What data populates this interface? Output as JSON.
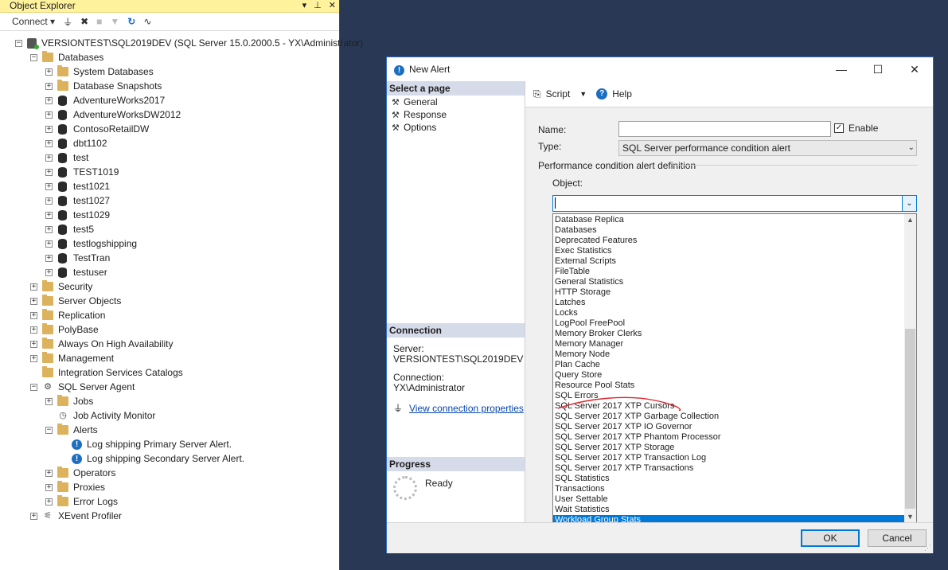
{
  "oe": {
    "title": "Object Explorer",
    "connect_label": "Connect",
    "tree": [
      {
        "label": "VERSIONTEST\\SQL2019DEV (SQL Server 15.0.2000.5 - YX\\Administrator)",
        "level": 0,
        "icon": "server-icon",
        "exp": "-"
      },
      {
        "label": "Databases",
        "level": 1,
        "icon": "folder-icon",
        "exp": "-"
      },
      {
        "label": "System Databases",
        "level": 2,
        "icon": "folder-icon",
        "exp": "+"
      },
      {
        "label": "Database Snapshots",
        "level": 2,
        "icon": "folder-icon",
        "exp": "+"
      },
      {
        "label": "AdventureWorks2017",
        "level": 2,
        "icon": "database-icon",
        "exp": "+"
      },
      {
        "label": "AdventureWorksDW2012",
        "level": 2,
        "icon": "database-icon",
        "exp": "+"
      },
      {
        "label": "ContosoRetailDW",
        "level": 2,
        "icon": "database-icon",
        "exp": "+"
      },
      {
        "label": "dbt1102",
        "level": 2,
        "icon": "database-icon",
        "exp": "+"
      },
      {
        "label": "test",
        "level": 2,
        "icon": "database-icon",
        "exp": "+"
      },
      {
        "label": "TEST1019",
        "level": 2,
        "icon": "database-icon",
        "exp": "+"
      },
      {
        "label": "test1021",
        "level": 2,
        "icon": "database-icon",
        "exp": "+"
      },
      {
        "label": "test1027",
        "level": 2,
        "icon": "database-icon",
        "exp": "+"
      },
      {
        "label": "test1029",
        "level": 2,
        "icon": "database-icon",
        "exp": "+"
      },
      {
        "label": "test5",
        "level": 2,
        "icon": "database-icon",
        "exp": "+"
      },
      {
        "label": "testlogshipping",
        "level": 2,
        "icon": "database-icon",
        "exp": "+"
      },
      {
        "label": "TestTran",
        "level": 2,
        "icon": "database-icon",
        "exp": "+"
      },
      {
        "label": "testuser",
        "level": 2,
        "icon": "database-icon",
        "exp": "+"
      },
      {
        "label": "Security",
        "level": 1,
        "icon": "folder-icon",
        "exp": "+"
      },
      {
        "label": "Server Objects",
        "level": 1,
        "icon": "folder-icon",
        "exp": "+"
      },
      {
        "label": "Replication",
        "level": 1,
        "icon": "folder-icon",
        "exp": "+"
      },
      {
        "label": "PolyBase",
        "level": 1,
        "icon": "folder-icon",
        "exp": "+"
      },
      {
        "label": "Always On High Availability",
        "level": 1,
        "icon": "folder-icon",
        "exp": "+"
      },
      {
        "label": "Management",
        "level": 1,
        "icon": "folder-icon",
        "exp": "+"
      },
      {
        "label": "Integration Services Catalogs",
        "level": 1,
        "icon": "folder-icon",
        "exp": ""
      },
      {
        "label": "SQL Server Agent",
        "level": 1,
        "icon": "agent-icon",
        "exp": "-"
      },
      {
        "label": "Jobs",
        "level": 2,
        "icon": "folder-icon",
        "exp": "+"
      },
      {
        "label": "Job Activity Monitor",
        "level": 2,
        "icon": "monitor-icon",
        "exp": ""
      },
      {
        "label": "Alerts",
        "level": 2,
        "icon": "folder-icon",
        "exp": "-"
      },
      {
        "label": "Log shipping Primary Server Alert.",
        "level": 3,
        "icon": "alert-icon",
        "exp": ""
      },
      {
        "label": "Log shipping Secondary Server Alert.",
        "level": 3,
        "icon": "alert-icon",
        "exp": ""
      },
      {
        "label": "Operators",
        "level": 2,
        "icon": "folder-icon",
        "exp": "+"
      },
      {
        "label": "Proxies",
        "level": 2,
        "icon": "folder-icon",
        "exp": "+"
      },
      {
        "label": "Error Logs",
        "level": 2,
        "icon": "folder-icon",
        "exp": "+"
      },
      {
        "label": "XEvent Profiler",
        "level": 1,
        "icon": "profiler-icon",
        "exp": "+"
      }
    ]
  },
  "dialog": {
    "title": "New Alert",
    "select_page": "Select a page",
    "pages": [
      "General",
      "Response",
      "Options"
    ],
    "connection_header": "Connection",
    "server_label": "Server:",
    "server_value": "VERSIONTEST\\SQL2019DEV",
    "connection_label": "Connection:",
    "connection_value": "YX\\Administrator",
    "view_conn_link": "View connection properties",
    "progress_header": "Progress",
    "progress_status": "Ready",
    "script_label": "Script",
    "help_label": "Help",
    "name_label": "Name:",
    "name_value": "",
    "enable_label": "Enable",
    "enable_checked": true,
    "type_label": "Type:",
    "type_value": "SQL Server performance condition alert",
    "perf_def_label": "Performance condition alert definition",
    "object_label": "Object:",
    "object_value": "",
    "object_options": [
      "Database Replica",
      "Databases",
      "Deprecated Features",
      "Exec Statistics",
      "External Scripts",
      "FileTable",
      "General Statistics",
      "HTTP Storage",
      "Latches",
      "Locks",
      "LogPool FreePool",
      "Memory Broker Clerks",
      "Memory Manager",
      "Memory Node",
      "Plan Cache",
      "Query Store",
      "Resource Pool Stats",
      "SQL Errors",
      "SQL Server 2017 XTP Cursors",
      "SQL Server 2017 XTP Garbage Collection",
      "SQL Server 2017 XTP IO Governor",
      "SQL Server 2017 XTP Phantom Processor",
      "SQL Server 2017 XTP Storage",
      "SQL Server 2017 XTP Transaction Log",
      "SQL Server 2017 XTP Transactions",
      "SQL Statistics",
      "Transactions",
      "User Settable",
      "Wait Statistics",
      "Workload Group Stats"
    ],
    "selected_option": "Workload Group Stats",
    "ok_label": "OK",
    "cancel_label": "Cancel"
  },
  "colors": {
    "title_bar": "#fff29d",
    "selection": "#0078d7",
    "background": "#293955",
    "annotation": "#e0242c"
  }
}
